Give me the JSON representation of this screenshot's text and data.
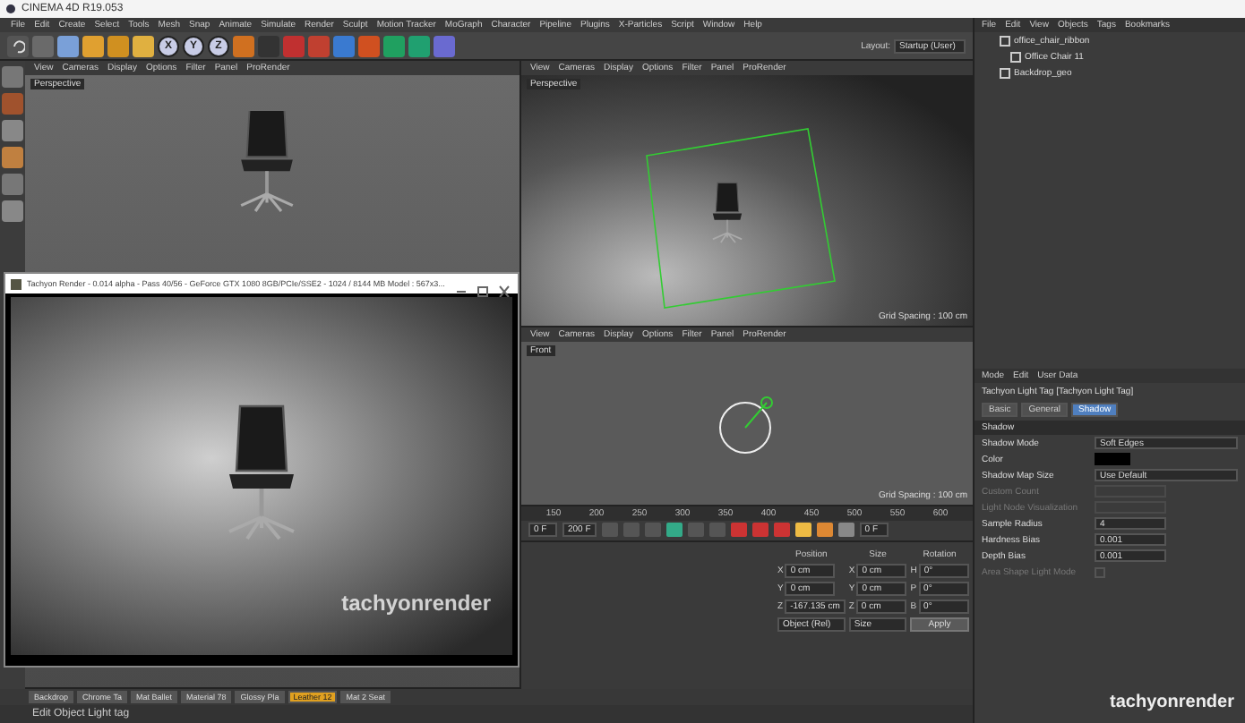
{
  "window": {
    "title": "CINEMA 4D R19.053"
  },
  "menu": [
    "File",
    "Edit",
    "Create",
    "Select",
    "Tools",
    "Mesh",
    "Snap",
    "Animate",
    "Simulate",
    "Render",
    "Sculpt",
    "Motion Tracker",
    "MoGraph",
    "Character",
    "Pipeline",
    "Plugins",
    "X-Particles",
    "Script",
    "Window",
    "Help"
  ],
  "toolbar": {
    "axis_buttons": [
      "X",
      "Y",
      "Z"
    ],
    "layout_label": "Layout:",
    "layout_value": "Startup (User)"
  },
  "viewports": [
    {
      "menu": [
        "View",
        "Cameras",
        "Display",
        "Options",
        "Filter",
        "Panel",
        "ProRender"
      ],
      "label": "Perspective"
    },
    {
      "menu": [
        "View",
        "Cameras",
        "Display",
        "Options",
        "Filter",
        "Panel",
        "ProRender"
      ],
      "label": "Perspective",
      "grid": "Grid Spacing : 100 cm"
    },
    {
      "menu": [
        "View",
        "Cameras",
        "Display",
        "Options",
        "Filter",
        "Panel",
        "ProRender"
      ],
      "label": "Front",
      "grid": "Grid Spacing : 100 cm"
    }
  ],
  "render_window": {
    "title": "Tachyon Render - 0.014 alpha - Pass 40/56 - GeForce GTX 1080 8GB/PCIe/SSE2 - 1024 / 8144 MB Model : 567x3...",
    "logo": "tachyonrender"
  },
  "timeline": {
    "ticks": [
      "150",
      "200",
      "250",
      "300",
      "350",
      "400",
      "450",
      "500",
      "550",
      "600"
    ],
    "frame": "0 F",
    "start": "0 F",
    "end": "200 F"
  },
  "coordinates": {
    "headers": [
      "Position",
      "Size",
      "Rotation"
    ],
    "rows": [
      {
        "axis": "X",
        "position": "0 cm",
        "size_axis": "X",
        "size": "0 cm",
        "rot_axis": "H",
        "rotation": "0°"
      },
      {
        "axis": "Y",
        "position": "0 cm",
        "size_axis": "Y",
        "size": "0 cm",
        "rot_axis": "P",
        "rotation": "0°"
      },
      {
        "axis": "Z",
        "position": "-167.135 cm",
        "size_axis": "Z",
        "size": "0 cm",
        "rot_axis": "B",
        "rotation": "0°"
      }
    ],
    "mode": "Object (Rel)",
    "size_mode": "Size",
    "apply": "Apply"
  },
  "object_manager": {
    "menu": [
      "File",
      "Edit",
      "View",
      "Objects",
      "Tags",
      "Bookmarks"
    ],
    "objects": [
      {
        "name": "office_chair_ribbon",
        "children": [
          {
            "name": "Office Chair 11"
          }
        ]
      },
      {
        "name": "Backdrop_geo"
      }
    ]
  },
  "attributes": {
    "menu": [
      "Mode",
      "Edit",
      "User Data"
    ],
    "title": "Tachyon Light Tag [Tachyon Light Tag]",
    "tabs": [
      {
        "label": "Basic",
        "selected": false
      },
      {
        "label": "General",
        "selected": false
      },
      {
        "label": "Shadow",
        "selected": true
      }
    ],
    "section": "Shadow",
    "fields": [
      {
        "kind": "dropdown",
        "label": "Shadow Mode",
        "value": "Soft Edges",
        "disabled": false
      },
      {
        "kind": "color",
        "label": "Color",
        "disabled": false
      },
      {
        "kind": "dropdown",
        "label": "Shadow Map Size",
        "value": "Use Default",
        "disabled": false
      },
      {
        "kind": "number",
        "label": "Custom Count",
        "disabled": true
      },
      {
        "kind": "number",
        "label": "Light Node Visualization",
        "disabled": true
      },
      {
        "kind": "number",
        "label": "Sample Radius",
        "value": "4",
        "disabled": false
      },
      {
        "kind": "number",
        "label": "Hardness Bias",
        "value": "0.001",
        "disabled": false
      },
      {
        "kind": "number",
        "label": "Depth Bias",
        "value": "0.001",
        "disabled": false
      },
      {
        "kind": "check",
        "label": "Area Shape Light Mode",
        "disabled": true
      }
    ]
  },
  "materials": [
    {
      "name": "Backdrop",
      "selected": false
    },
    {
      "name": "Chrome Ta",
      "selected": false
    },
    {
      "name": "Mat Ballet",
      "selected": false
    },
    {
      "name": "Material 78",
      "selected": false
    },
    {
      "name": "Glossy Pla",
      "selected": false
    },
    {
      "name": "Leather 12",
      "selected": true
    },
    {
      "name": "Mat 2 Seat",
      "selected": false
    }
  ],
  "status_bar": "Edit Object Light tag",
  "brand_logo": "tachyonrender"
}
